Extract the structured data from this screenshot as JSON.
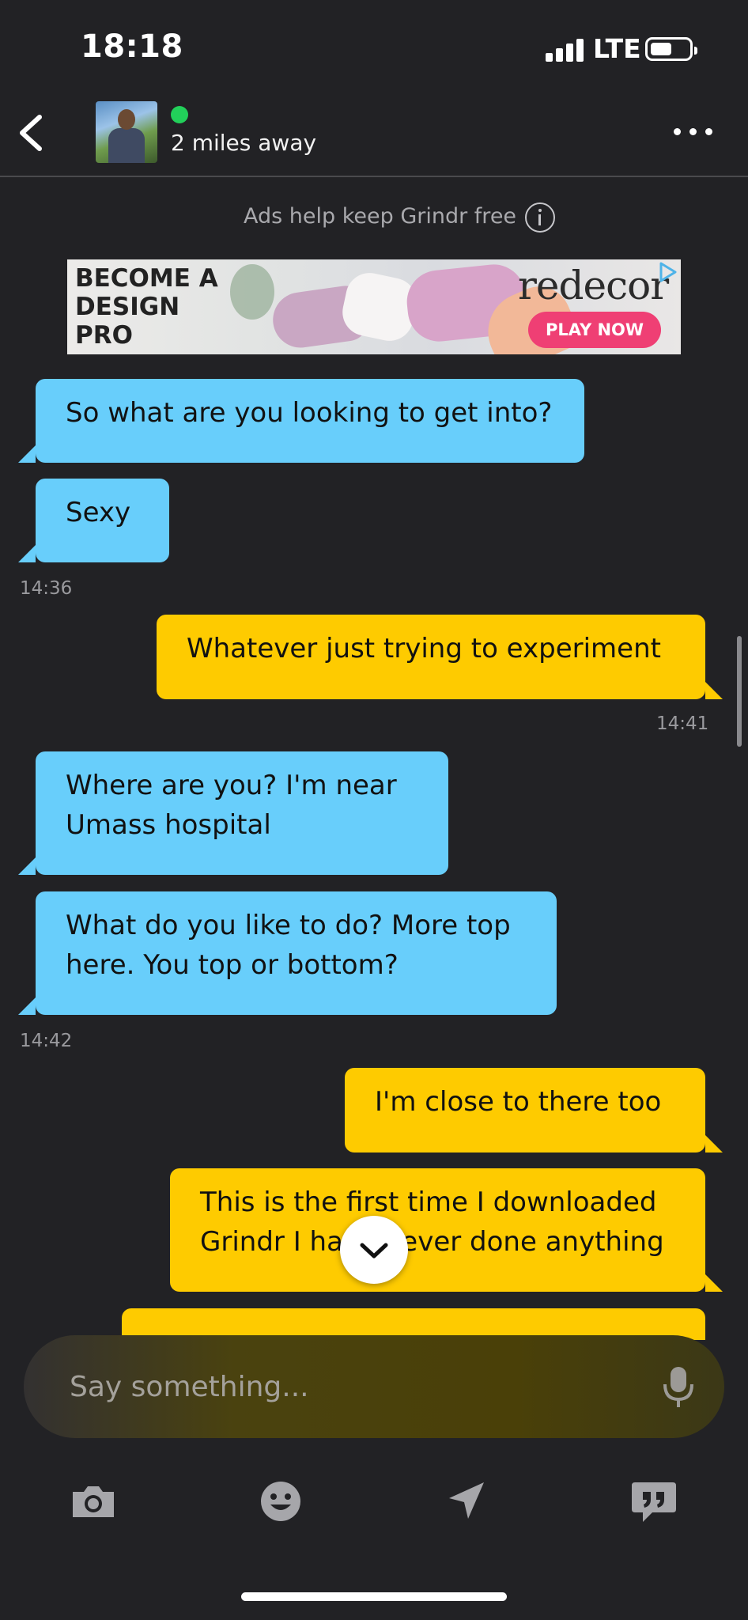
{
  "status_bar": {
    "time": "18:18",
    "network": "LTE",
    "battery_level": 0.55
  },
  "header": {
    "distance": "2 miles away",
    "online": true
  },
  "ads": {
    "note": "Ads help keep Grindr free",
    "banner": {
      "headline": "BECOME A DESIGN PRO",
      "brand": "redecor",
      "cta": "PLAY NOW"
    }
  },
  "messages": [
    {
      "from": "them",
      "text": "So what are you looking to get into?"
    },
    {
      "from": "them",
      "text": "Sexy"
    },
    {
      "timestamp": "14:36"
    },
    {
      "from": "me",
      "text": "Whatever just trying to experiment"
    },
    {
      "timestamp": "14:41"
    },
    {
      "from": "them",
      "text": "Where are you?  I'm near Umass hospital"
    },
    {
      "from": "them",
      "text": "What do you like to do?  More top here. You top or bottom?"
    },
    {
      "timestamp": "14:42"
    },
    {
      "from": "me",
      "text": "I'm close to there too"
    },
    {
      "from": "me",
      "text": "This is the first time I downloaded Grindr I have never done anything"
    }
  ],
  "composer": {
    "placeholder": "Say something..."
  },
  "toolbar": [
    "camera-icon",
    "emoji-icon",
    "location-icon",
    "saved-phrases-icon"
  ],
  "colors": {
    "background": "#222225",
    "incoming": "#68cefb",
    "outgoing": "#fecb00",
    "online": "#22d05a",
    "cta": "#ef3f74"
  }
}
